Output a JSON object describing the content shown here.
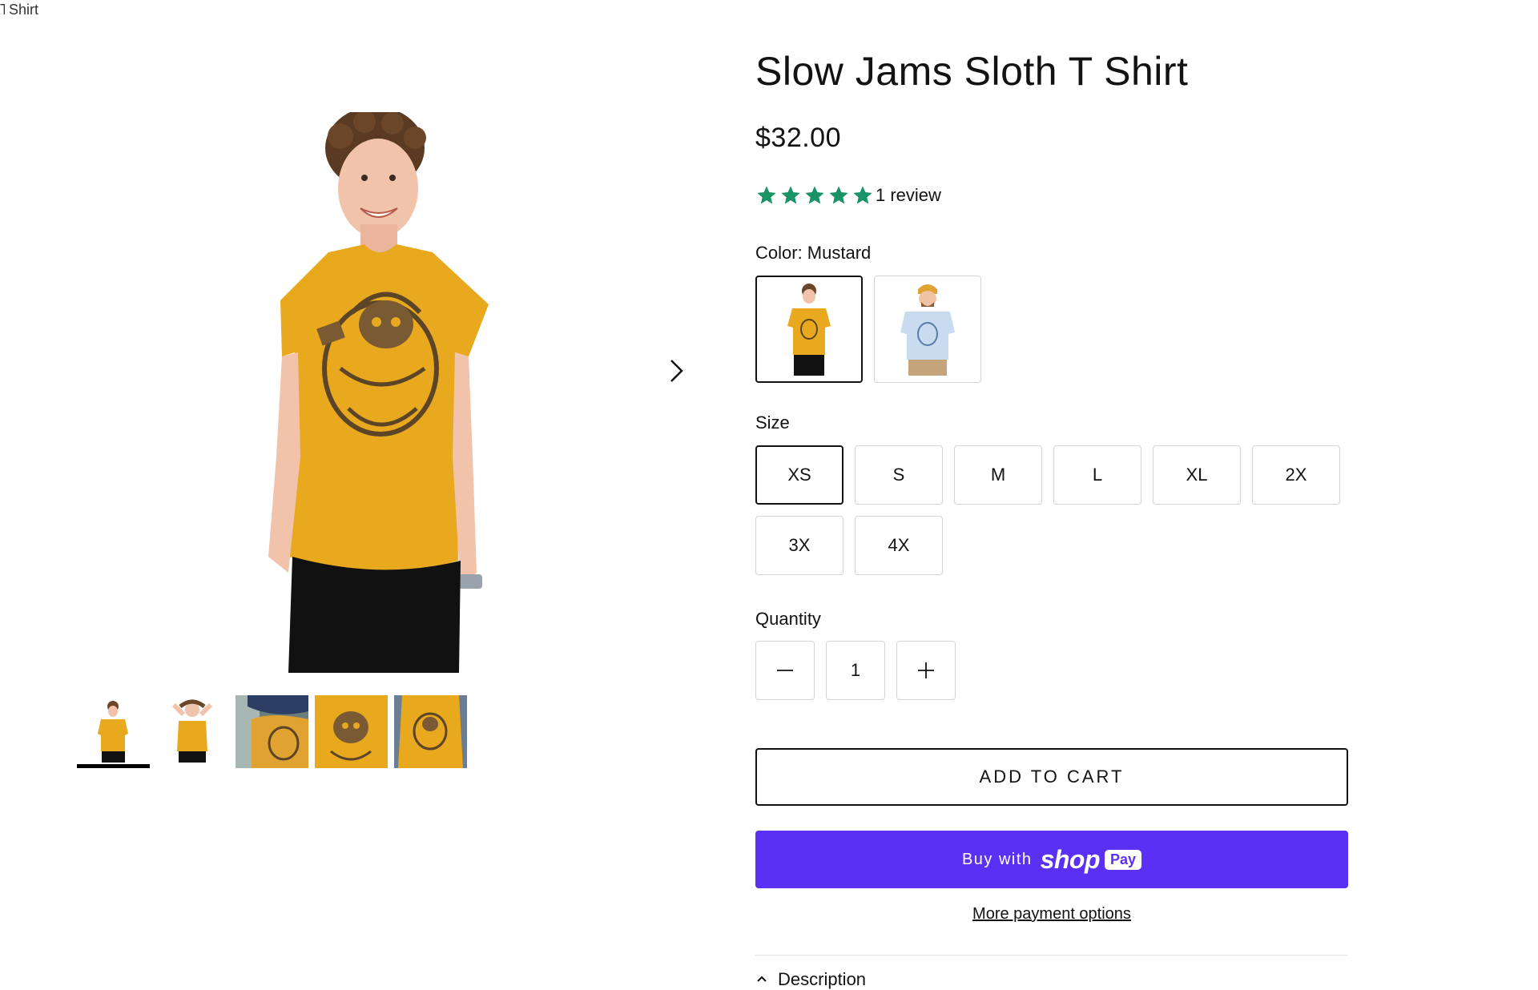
{
  "breadcrumb": {
    "text": "Shirt"
  },
  "product": {
    "title": "Slow Jams Sloth T Shirt",
    "price": "$32.00",
    "rating": {
      "stars": 5,
      "max": 5,
      "review_text": "1 review",
      "star_color": "#1a9366"
    }
  },
  "gallery": {
    "next_icon": "chevron-right-icon",
    "thumbnails": [
      {
        "alt": "mustard-full-body",
        "active": true
      },
      {
        "alt": "mustard-posing"
      },
      {
        "alt": "blue-hat-closeup"
      },
      {
        "alt": "mustard-print-closeup"
      },
      {
        "alt": "mustard-front-closeup"
      }
    ]
  },
  "color": {
    "label": "Color: Mustard",
    "swatches": [
      {
        "name": "Mustard",
        "shirt_color": "#e8a91f",
        "selected": true
      },
      {
        "name": "Light Blue",
        "shirt_color": "#c9dcef",
        "selected": false
      }
    ]
  },
  "size": {
    "label": "Size",
    "options": [
      "XS",
      "S",
      "M",
      "L",
      "XL",
      "2X",
      "3X",
      "4X"
    ],
    "selected": "XS"
  },
  "quantity": {
    "label": "Quantity",
    "value": "1",
    "minus_icon": "minus-icon",
    "plus_icon": "plus-icon"
  },
  "actions": {
    "add_to_cart": "ADD TO CART",
    "shop_pay_prefix": "Buy with",
    "shop_pay_word": "shop",
    "shop_pay_badge": "Pay",
    "shop_pay_color": "#5a31f4",
    "more_options": "More payment options"
  },
  "description": {
    "label": "Description"
  }
}
